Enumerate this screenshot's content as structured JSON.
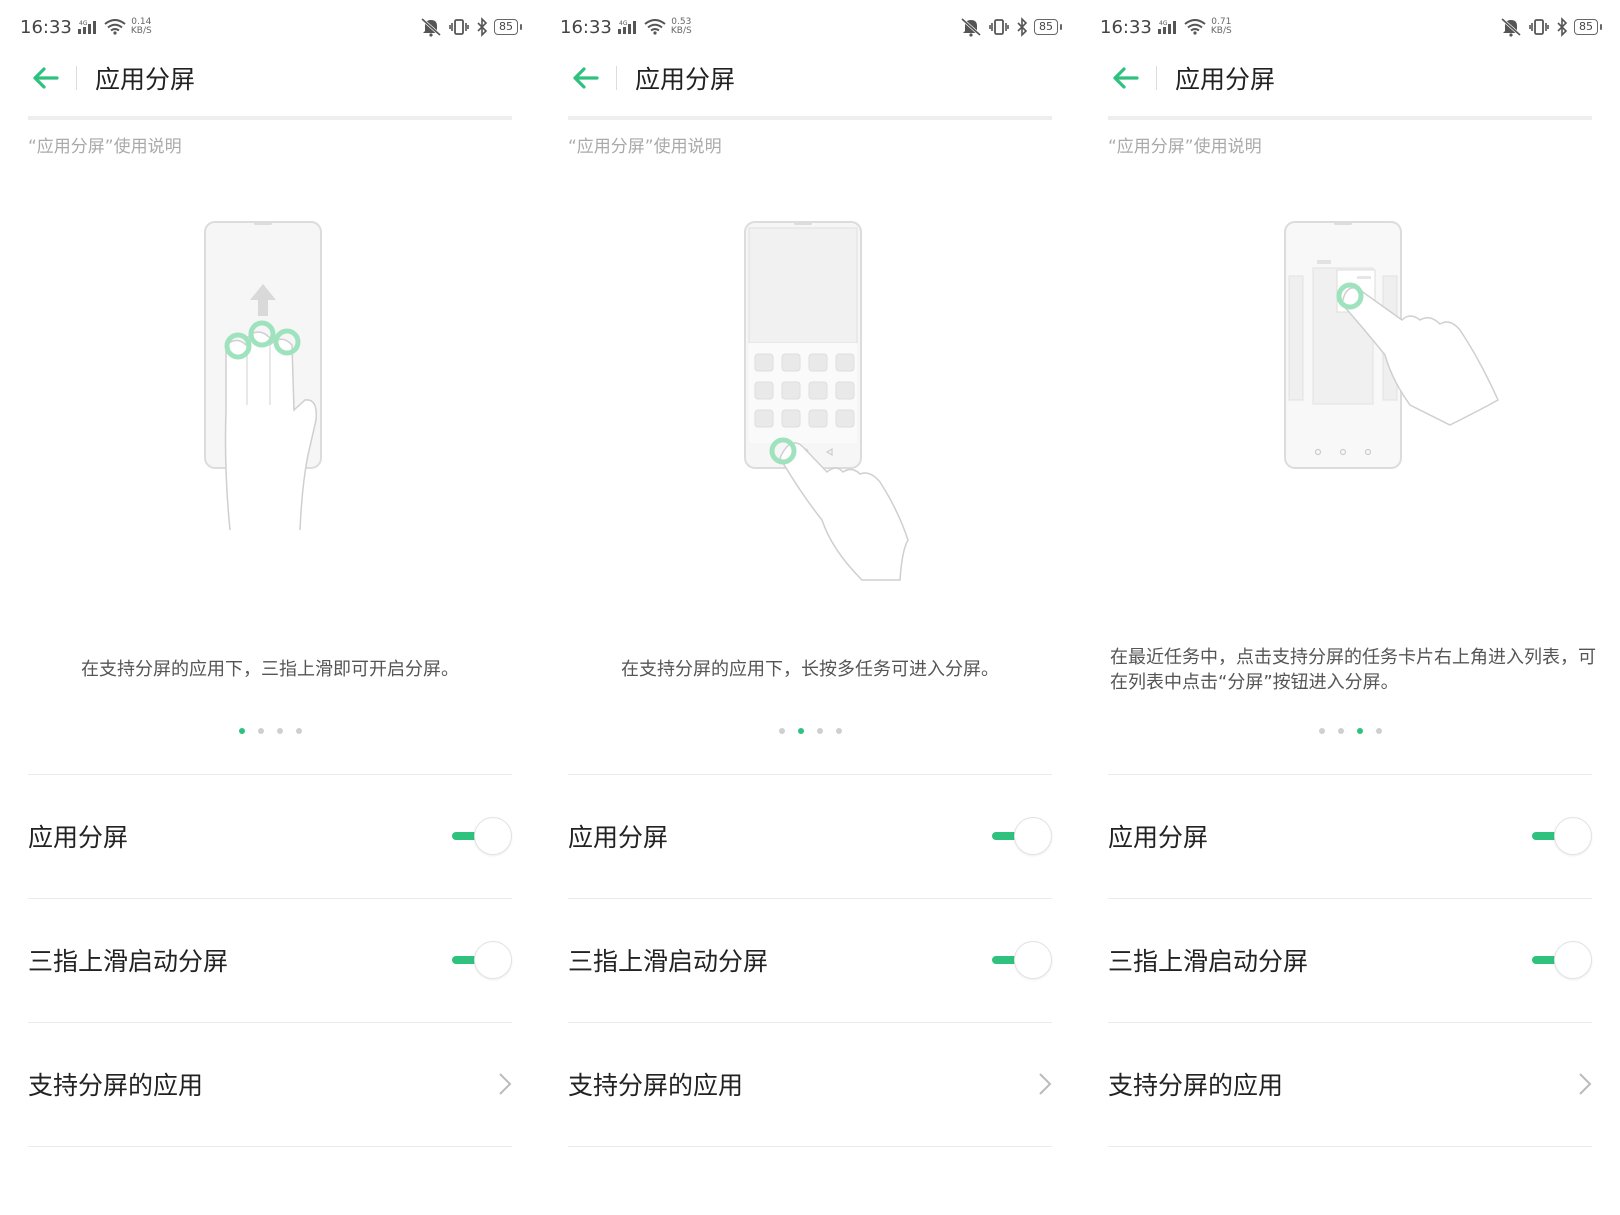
{
  "status": {
    "time": "16:33",
    "network": "4G",
    "battery": "85",
    "speed_unit": "KB/S"
  },
  "header": {
    "title": "应用分屏"
  },
  "intro_link": "“应用分屏”使用说明",
  "screens": [
    {
      "speed": "0.14",
      "caption": "在支持分屏的应用下，三指上滑即可开启分屏。",
      "active_dot": 0
    },
    {
      "speed": "0.53",
      "caption": "在支持分屏的应用下，长按多任务可进入分屏。",
      "active_dot": 1
    },
    {
      "speed": "0.71",
      "caption": "在最近任务中，点击支持分屏的任务卡片右上角进入列表，可在列表中点击“分屏”按钮进入分屏。",
      "active_dot": 2
    }
  ],
  "settings": {
    "split_screen": {
      "label": "应用分屏",
      "enabled": true
    },
    "three_finger": {
      "label": "三指上滑启动分屏",
      "enabled": true
    },
    "supported_apps": {
      "label": "支持分屏的应用"
    }
  },
  "colors": {
    "accent": "#2ec27e",
    "divider": "#ececec"
  }
}
